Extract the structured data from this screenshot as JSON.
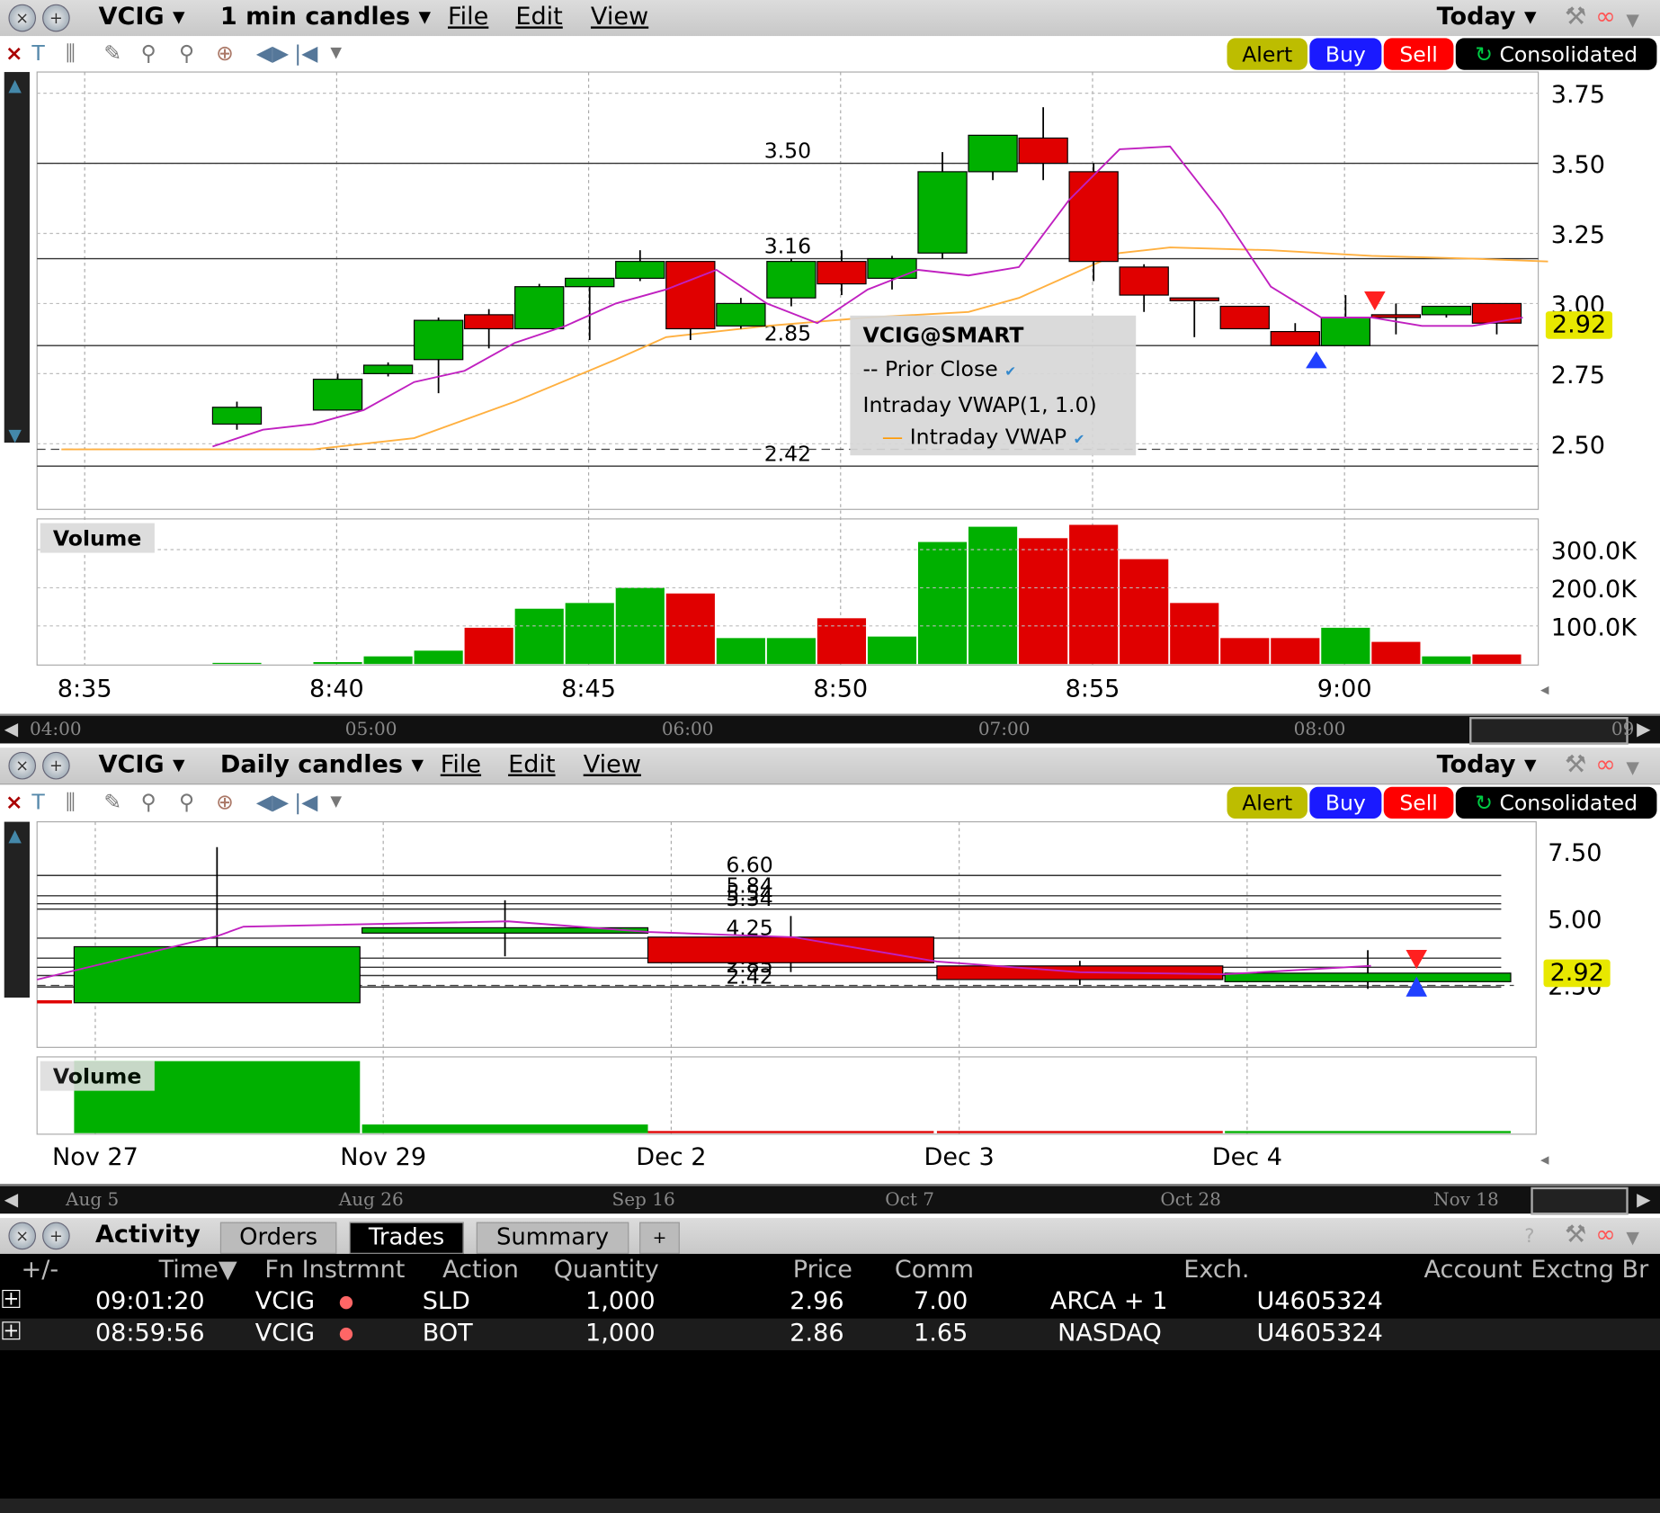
{
  "window1": {
    "symbol": "VCIG",
    "interval": "1 min candles",
    "menu": [
      "File",
      "Edit",
      "View"
    ],
    "range": "Today",
    "buttons": {
      "alert": "Alert",
      "buy": "Buy",
      "sell": "Sell",
      "consolidated": "Consolidated"
    },
    "legend": {
      "title": "VCIG@SMART",
      "prior_close": "Prior Close",
      "indicator": "Intraday VWAP(1, 1.0)",
      "vwap": "Intraday VWAP"
    },
    "volume_label": "Volume",
    "last_price": "2.92",
    "scroll_labels": [
      "04:00",
      "05:00",
      "06:00",
      "07:00",
      "08:00",
      "09"
    ]
  },
  "window2": {
    "symbol": "VCIG",
    "interval": "Daily candles",
    "menu": [
      "File",
      "Edit",
      "View"
    ],
    "range": "Today",
    "buttons": {
      "alert": "Alert",
      "buy": "Buy",
      "sell": "Sell",
      "consolidated": "Consolidated"
    },
    "volume_label": "Volume",
    "last_price": "2.92",
    "scroll_labels": [
      "Aug 5",
      "Aug 26",
      "Sep 16",
      "Oct 7",
      "Oct 28",
      "Nov 18"
    ]
  },
  "chart_data": [
    {
      "type": "candlestick",
      "title": "VCIG 1 min candles",
      "y_ticks": [
        "3.75",
        "3.50",
        "3.25",
        "3.00",
        "2.75",
        "2.50"
      ],
      "ylim": [
        2.4,
        3.82
      ],
      "x_ticks": [
        "8:35",
        "8:40",
        "8:45",
        "8:50",
        "8:55",
        "9:00"
      ],
      "level_lines": [
        "3.50",
        "3.16",
        "2.85",
        "2.42"
      ],
      "prior_close": 2.48,
      "candles": [
        {
          "t": "8:38",
          "o": 2.57,
          "h": 2.65,
          "l": 2.55,
          "c": 2.63
        },
        {
          "t": "8:40",
          "o": 2.62,
          "h": 2.75,
          "l": 2.62,
          "c": 2.73
        },
        {
          "t": "8:41",
          "o": 2.75,
          "h": 2.79,
          "l": 2.74,
          "c": 2.78
        },
        {
          "t": "8:42",
          "o": 2.8,
          "h": 2.95,
          "l": 2.68,
          "c": 2.94
        },
        {
          "t": "8:43",
          "o": 2.96,
          "h": 2.98,
          "l": 2.84,
          "c": 2.91
        },
        {
          "t": "8:44",
          "o": 2.91,
          "h": 3.07,
          "l": 2.91,
          "c": 3.06
        },
        {
          "t": "8:45",
          "o": 3.06,
          "h": 3.09,
          "l": 2.87,
          "c": 3.09
        },
        {
          "t": "8:46",
          "o": 3.09,
          "h": 3.19,
          "l": 3.08,
          "c": 3.15
        },
        {
          "t": "8:47",
          "o": 3.15,
          "h": 3.15,
          "l": 2.87,
          "c": 2.91
        },
        {
          "t": "8:48",
          "o": 2.92,
          "h": 3.02,
          "l": 2.91,
          "c": 3.0
        },
        {
          "t": "8:49",
          "o": 3.02,
          "h": 3.16,
          "l": 2.99,
          "c": 3.15
        },
        {
          "t": "8:50",
          "o": 3.15,
          "h": 3.19,
          "l": 3.03,
          "c": 3.07
        },
        {
          "t": "8:51",
          "o": 3.09,
          "h": 3.17,
          "l": 3.05,
          "c": 3.16
        },
        {
          "t": "8:52",
          "o": 3.18,
          "h": 3.54,
          "l": 3.16,
          "c": 3.47
        },
        {
          "t": "8:53",
          "o": 3.47,
          "h": 3.6,
          "l": 3.44,
          "c": 3.6
        },
        {
          "t": "8:54",
          "o": 3.59,
          "h": 3.7,
          "l": 3.44,
          "c": 3.5
        },
        {
          "t": "8:55",
          "o": 3.47,
          "h": 3.5,
          "l": 3.08,
          "c": 3.15
        },
        {
          "t": "8:56",
          "o": 3.13,
          "h": 3.14,
          "l": 2.97,
          "c": 3.03
        },
        {
          "t": "8:57",
          "o": 3.02,
          "h": 3.02,
          "l": 2.88,
          "c": 3.01
        },
        {
          "t": "8:58",
          "o": 2.99,
          "h": 2.99,
          "l": 2.91,
          "c": 2.91
        },
        {
          "t": "8:59",
          "o": 2.9,
          "h": 2.93,
          "l": 2.85,
          "c": 2.85
        },
        {
          "t": "9:00",
          "o": 2.85,
          "h": 3.03,
          "l": 2.85,
          "c": 2.95
        },
        {
          "t": "9:01",
          "o": 2.96,
          "h": 3.0,
          "l": 2.89,
          "c": 2.95
        },
        {
          "t": "9:02",
          "o": 2.96,
          "h": 2.99,
          "l": 2.95,
          "c": 2.99
        },
        {
          "t": "9:03",
          "o": 3.0,
          "h": 3.0,
          "l": 2.89,
          "c": 2.93
        }
      ],
      "ema_line": [
        [
          3,
          2.49
        ],
        [
          4,
          2.55
        ],
        [
          5,
          2.57
        ],
        [
          6,
          2.62
        ],
        [
          7,
          2.72
        ],
        [
          8,
          2.76
        ],
        [
          9,
          2.86
        ],
        [
          10,
          2.92
        ],
        [
          11,
          3.0
        ],
        [
          12,
          3.05
        ],
        [
          13,
          3.12
        ],
        [
          14,
          3.0
        ],
        [
          15,
          2.93
        ],
        [
          16,
          3.05
        ],
        [
          17,
          3.12
        ],
        [
          18,
          3.1
        ],
        [
          19,
          3.13
        ],
        [
          20,
          3.37
        ],
        [
          21,
          3.55
        ],
        [
          22,
          3.56
        ],
        [
          23,
          3.33
        ],
        [
          24,
          3.06
        ],
        [
          25,
          2.95
        ],
        [
          26,
          2.95
        ],
        [
          27,
          2.92
        ],
        [
          28,
          2.92
        ],
        [
          29,
          2.95
        ]
      ],
      "vwap_line": [
        [
          0,
          2.48
        ],
        [
          5,
          2.48
        ],
        [
          7,
          2.52
        ],
        [
          9,
          2.65
        ],
        [
          11,
          2.8
        ],
        [
          12,
          2.88
        ],
        [
          14,
          2.92
        ],
        [
          16,
          2.95
        ],
        [
          18,
          2.97
        ],
        [
          19,
          3.02
        ],
        [
          20,
          3.1
        ],
        [
          21,
          3.18
        ],
        [
          22,
          3.2
        ],
        [
          24,
          3.19
        ],
        [
          26,
          3.17
        ],
        [
          28,
          3.16
        ],
        [
          29.5,
          3.15
        ]
      ],
      "volume": {
        "y_ticks": [
          "300.0K",
          "200.0K",
          "100.0K"
        ],
        "values": [
          3,
          0,
          5,
          20,
          35,
          95,
          145,
          160,
          200,
          185,
          68,
          68,
          120,
          72,
          320,
          360,
          330,
          365,
          275,
          160,
          68,
          68,
          95,
          58,
          20,
          25
        ],
        "unit": "K"
      },
      "trade_markers": [
        {
          "t": "8:59",
          "side": "buy",
          "price": 2.86
        },
        {
          "t": "9:01",
          "side": "sell",
          "price": 2.96
        }
      ]
    },
    {
      "type": "candlestick",
      "title": "VCIG Daily candles",
      "y_ticks": [
        "7.50",
        "5.00",
        "2.50"
      ],
      "x_ticks": [
        "Nov 27",
        "Nov 29",
        "Dec 2",
        "Dec 3",
        "Dec 4"
      ],
      "level_lines": [
        "6.60",
        "5.84",
        "5.54",
        "5.34",
        "4.25",
        "3.50",
        "3.16",
        "2.85",
        "2.42"
      ],
      "candles": [
        {
          "t": "Nov 27",
          "o": 1.83,
          "h": 7.66,
          "l": 1.9,
          "c": 3.93
        },
        {
          "t": "Nov 29",
          "o": 4.44,
          "h": 5.67,
          "l": 3.57,
          "c": 4.64
        },
        {
          "t": "Dec 2",
          "o": 4.29,
          "h": 5.08,
          "l": 2.98,
          "c": 3.33
        },
        {
          "t": "Dec 3",
          "o": 3.21,
          "h": 3.4,
          "l": 2.5,
          "c": 2.7
        },
        {
          "t": "Dec 4",
          "o": 2.62,
          "h": 3.8,
          "l": 2.35,
          "c": 2.94
        }
      ],
      "volume_relative": [
        1.0,
        0.12,
        0.02,
        0.0,
        0.02
      ]
    }
  ],
  "activity": {
    "title": "Activity",
    "tabs": [
      "Orders",
      "Trades",
      "Summary",
      "+"
    ],
    "active_tab": "Trades",
    "columns": [
      "+/-",
      "Time",
      "Fn Instrmnt",
      "Action",
      "Quantity",
      "Price",
      "Comm",
      "Exch.",
      "Account",
      "Exctng Br"
    ],
    "rows": [
      {
        "time": "09:01:20",
        "symbol": "VCIG",
        "action": "SLD",
        "quantity": "1,000",
        "price": "2.96",
        "comm": "7.00",
        "exch": "ARCA + 1",
        "account": "U4605324"
      },
      {
        "time": "08:59:56",
        "symbol": "VCIG",
        "action": "BOT",
        "quantity": "1,000",
        "price": "2.86",
        "comm": "1.65",
        "exch": "NASDAQ",
        "account": "U4605324"
      }
    ]
  },
  "colors": {
    "up": "#00b000",
    "down": "#e00000",
    "ema": "#c020c0",
    "vwap": "#ffb040",
    "price_tag": "#e8e800"
  }
}
